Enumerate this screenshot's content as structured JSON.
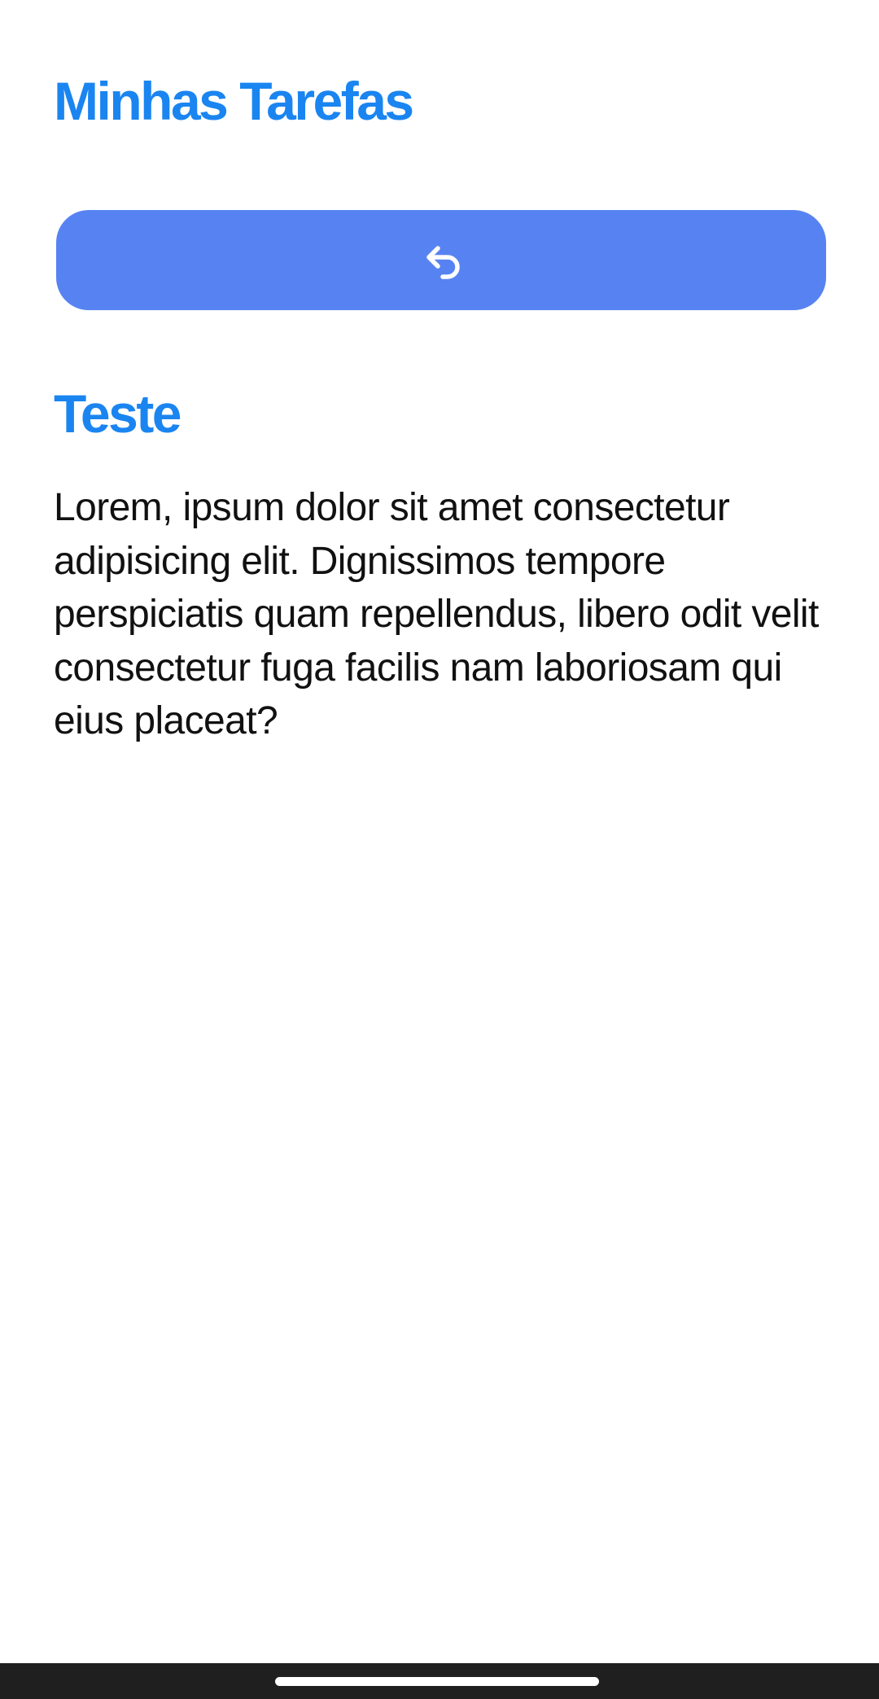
{
  "header": {
    "title": "Minhas Tarefas"
  },
  "back_button": {
    "icon": "undo-arrow-icon"
  },
  "task": {
    "title": "Teste",
    "description": "Lorem, ipsum dolor sit amet consectetur adipisicing elit. Dignissimos tempore perspiciatis quam repellendus, libero odit velit consectetur fuga facilis nam laboriosam qui eius placeat?"
  },
  "colors": {
    "accent": "#1a85f0",
    "button": "#5783f2",
    "text": "#111111",
    "background": "#ffffff",
    "nav_bar": "#1f1f1f"
  }
}
